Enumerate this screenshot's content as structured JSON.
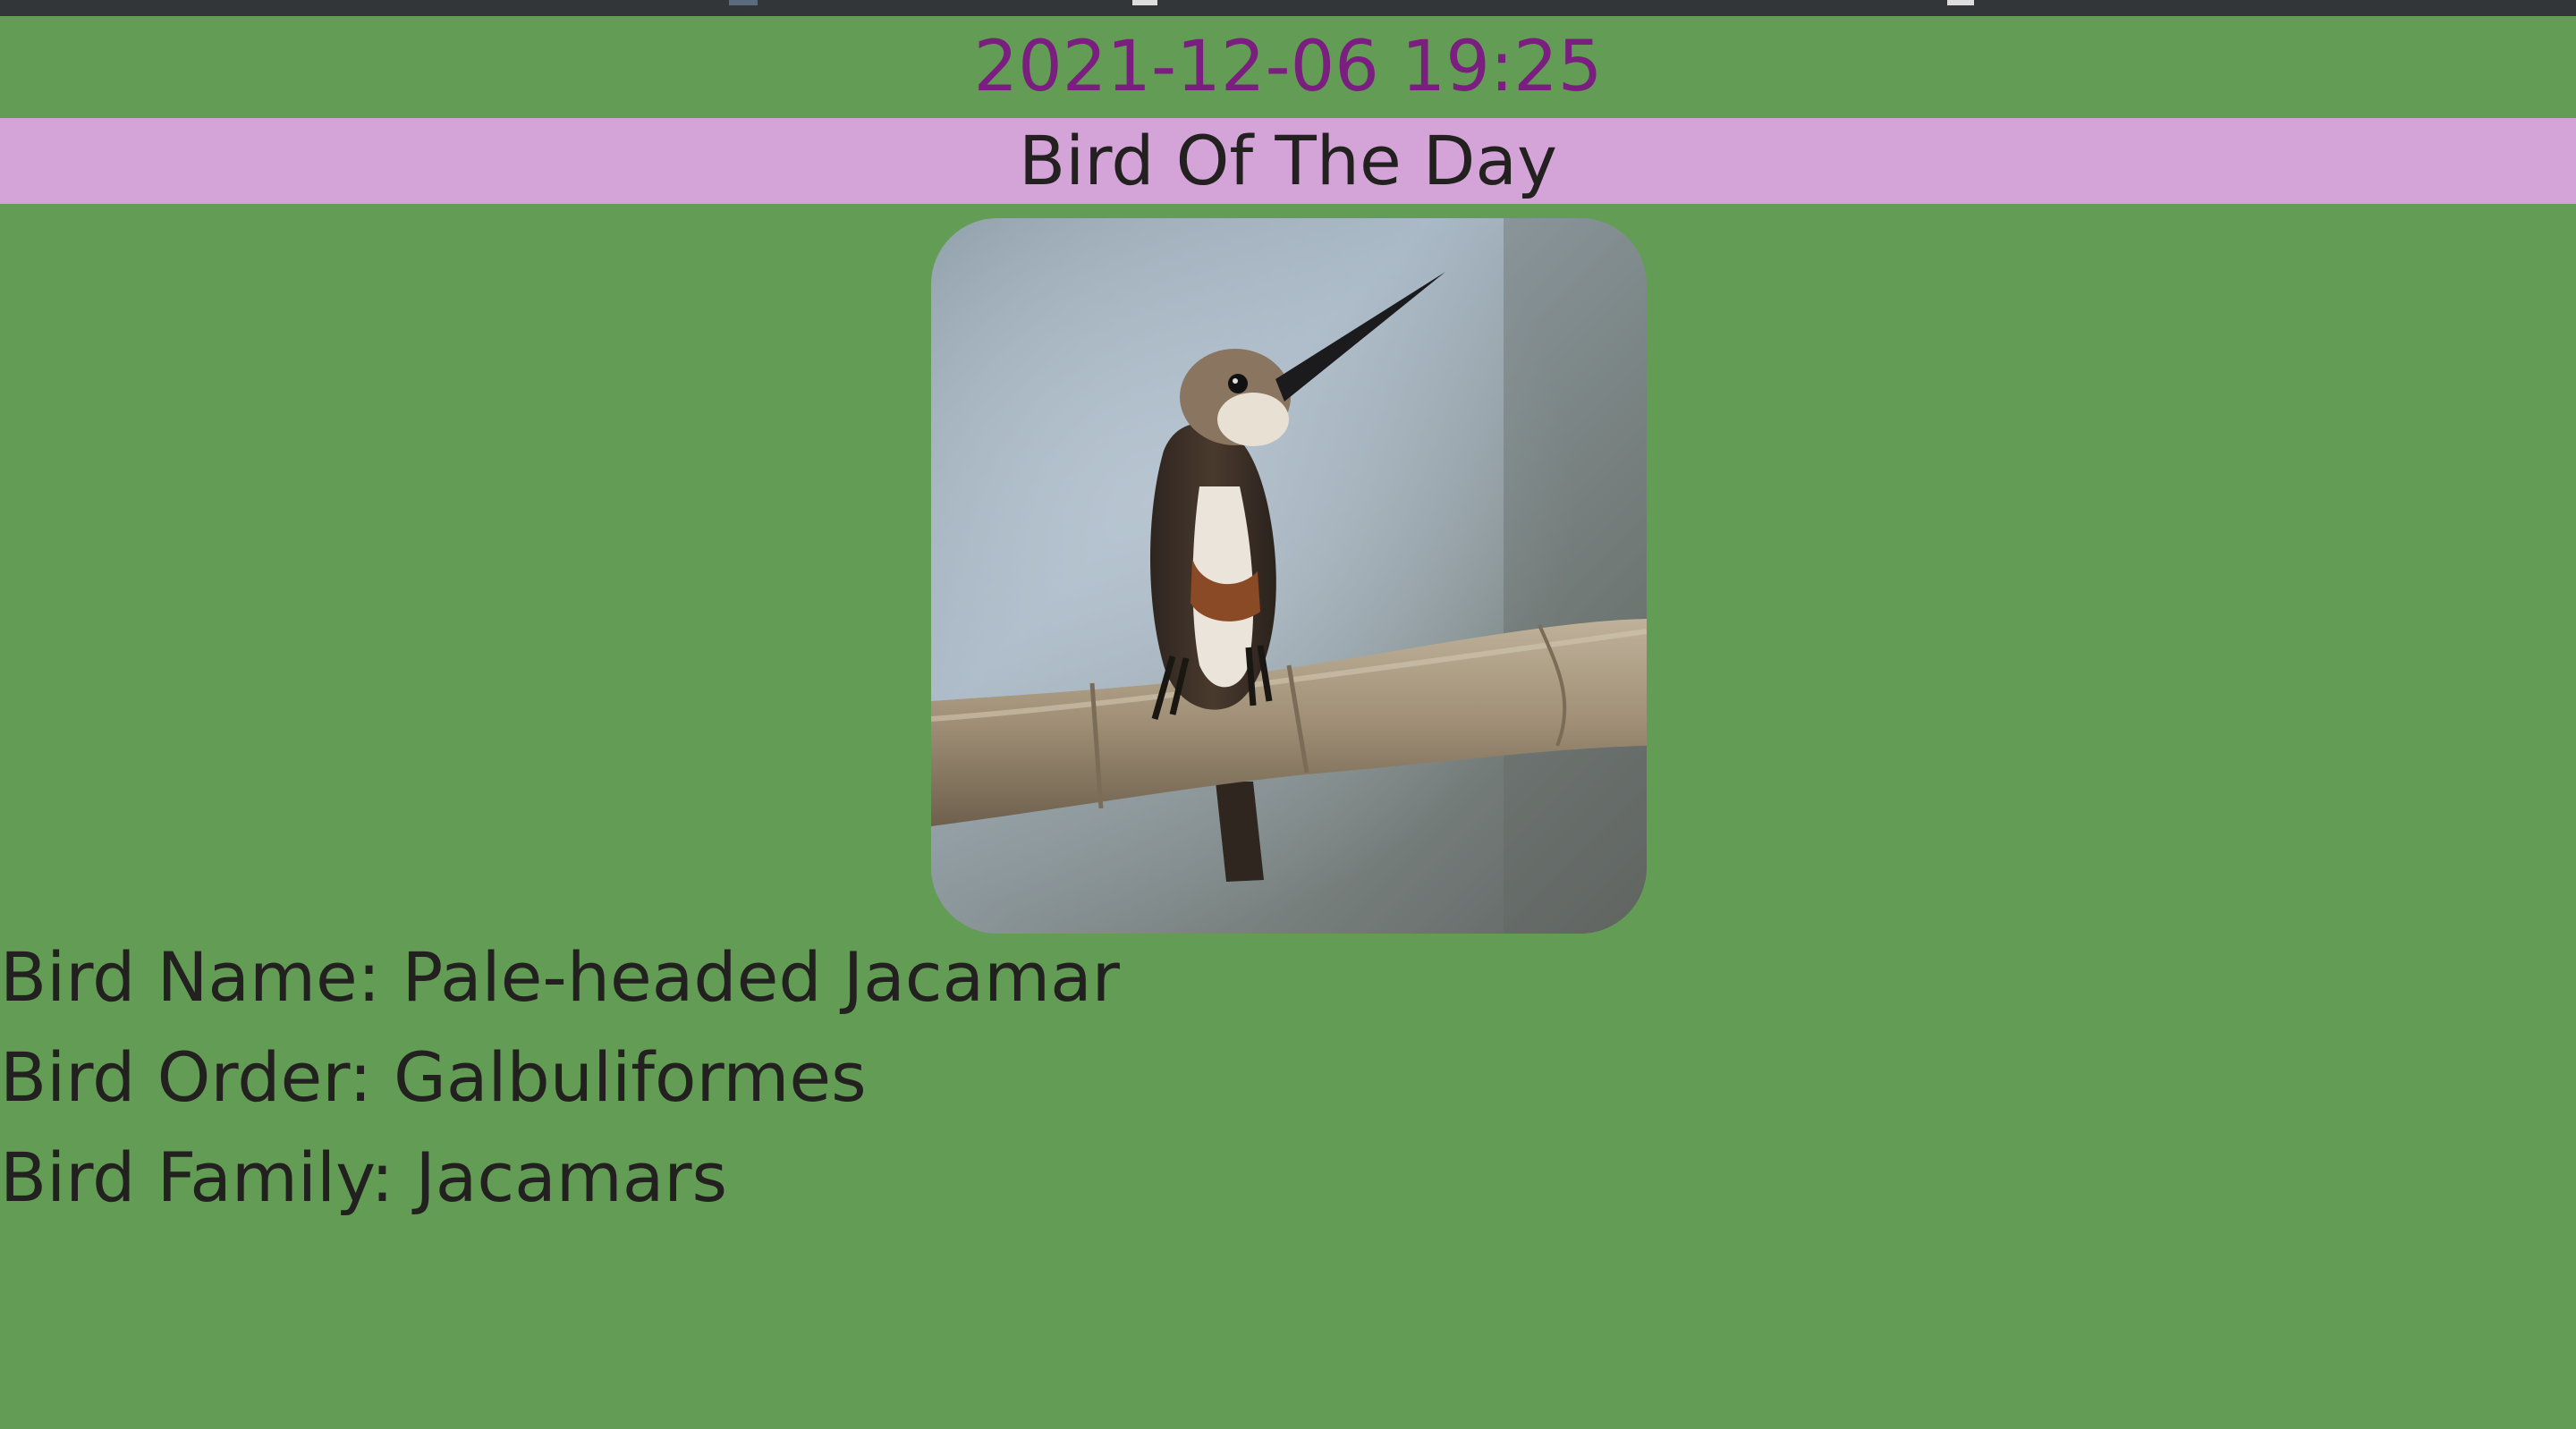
{
  "datetime": "2021-12-06 19:25",
  "banner_title": "Bird Of The Day",
  "photo": {
    "subject": "bird-photo"
  },
  "bird_name_line": "Bird Name: Pale-headed Jacamar",
  "bird_order_line": "Bird Order: Galbuliformes",
  "bird_family_line": "Bird Family: Jacamars",
  "colors": {
    "page_background": "#639d55",
    "banner_background": "#d4a4d8",
    "datetime_text": "#7a1f80",
    "body_text": "#232020"
  }
}
